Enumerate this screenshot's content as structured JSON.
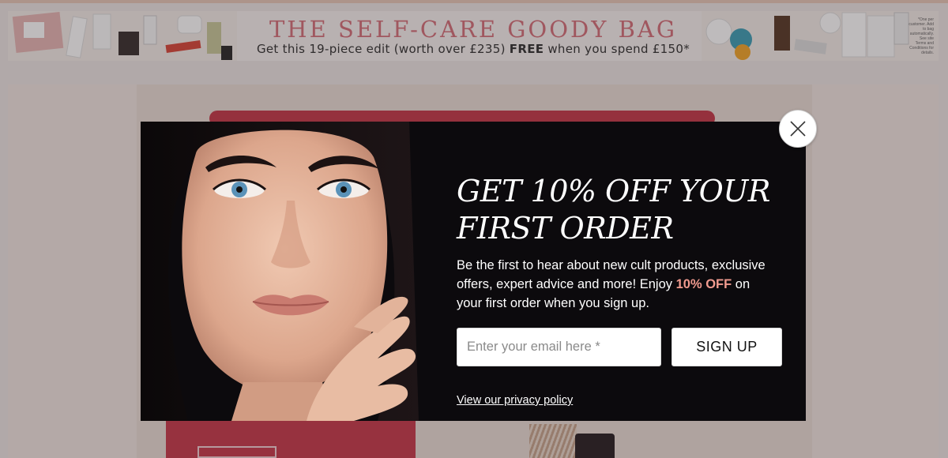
{
  "banner": {
    "title": "THE SELF-CARE GOODY BAG",
    "subtitle_pre": "Get this 19-piece edit (worth over £235) ",
    "subtitle_bold": "FREE",
    "subtitle_post": " when you spend £150*",
    "fine_print": "*One per customer. Add to bag automatically. See site Terms and Conditions for details."
  },
  "modal": {
    "title": "GET 10% OFF YOUR FIRST ORDER",
    "desc_pre": "Be the first to hear about new cult products, exclusive offers, expert advice and more! Enjoy ",
    "desc_highlight": "10% OFF",
    "desc_post": " on your first order when you sign up.",
    "email_placeholder": "Enter your email here *",
    "signup_label": "SIGN UP",
    "privacy_link": "View our privacy policy",
    "close_icon": "close-icon"
  },
  "colors": {
    "modal_bg": "#0c0a0d",
    "highlight": "#f19b8f",
    "banner_title": "#d4707a"
  }
}
